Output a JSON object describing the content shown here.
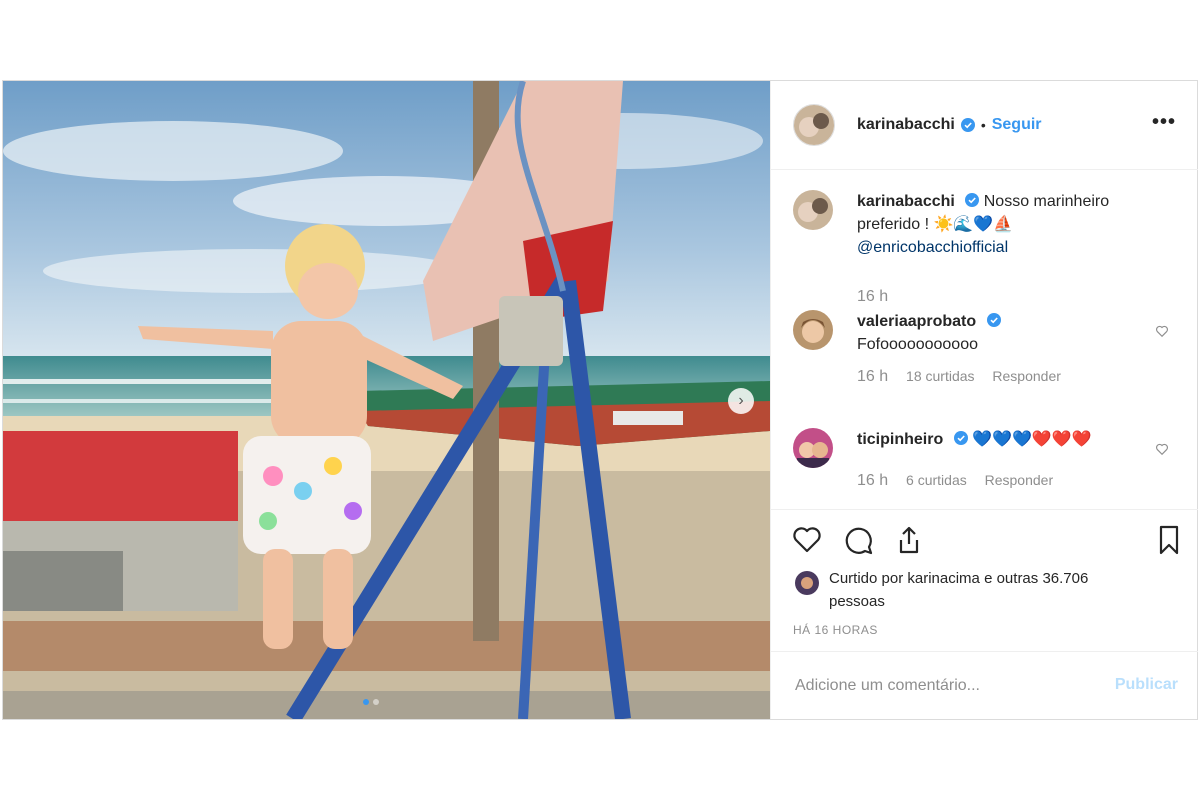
{
  "post": {
    "author": "karinabacchi",
    "follow_label": "Seguir",
    "separator": "•",
    "more_label": "•••",
    "photo_alt": "Foto do post",
    "caption": {
      "username": "karinabacchi",
      "text": "Nosso marinheiro preferido ! ☀️🌊💙⛵",
      "mention": "@enricobacchiofficial",
      "time": "16 h"
    },
    "comments": [
      {
        "username": "valeriaaprobato",
        "text": "Fofooooooooooo",
        "time": "16 h",
        "likes": "18 curtidas",
        "reply": "Responder"
      },
      {
        "username": "ticipinheiro",
        "text": "💙💙💙❤️❤️❤️",
        "time": "16 h",
        "likes": "6 curtidas",
        "reply": "Responder"
      }
    ],
    "liked_by": {
      "prefix": "Curtido por",
      "user": "karinacima",
      "suffix": "e outras 36.706 pessoas"
    },
    "time_ago": "HÁ 16 HORAS",
    "comment_input": {
      "placeholder": "Adicione um comentário..."
    },
    "publish_label": "Publicar",
    "next_label": "›"
  },
  "colors": {
    "link": "#3897f0",
    "publish_disabled": "#b9dffc",
    "verified": "#3897f0"
  }
}
